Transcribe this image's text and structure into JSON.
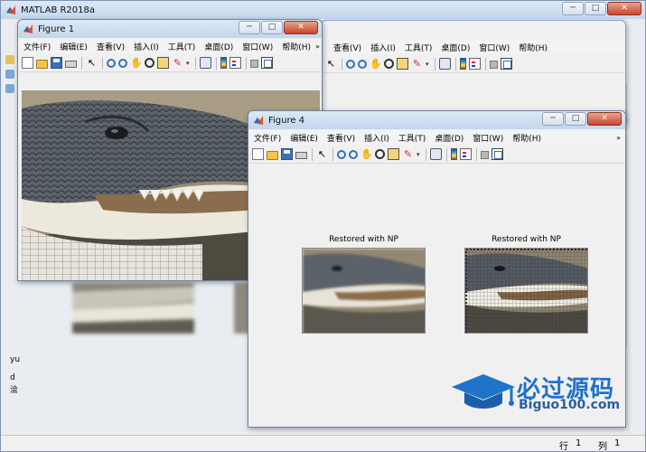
{
  "main_window": {
    "title": "MATLAB R2018a",
    "menu_behind": [
      "查看(V)",
      "插入(I)",
      "工具(T)",
      "桌面(D)",
      "窗口(W)",
      "帮助(H)"
    ],
    "command_snippets": [
      "yu",
      "d",
      "浍"
    ],
    "status": {
      "row_label": "行",
      "row_value": "1",
      "col_label": "列",
      "col_value": "1"
    }
  },
  "figure1": {
    "title": "Figure 1",
    "menu": [
      "文件(F)",
      "编辑(E)",
      "查看(V)",
      "插入(I)",
      "工具(T)",
      "桌面(D)",
      "窗口(W)",
      "帮助(H)"
    ],
    "menu_more": "»",
    "photo": "alligator"
  },
  "figure4": {
    "title": "Figure 4",
    "menu": [
      "文件(F)",
      "编辑(E)",
      "查看(V)",
      "插入(I)",
      "工具(T)",
      "桌面(D)",
      "窗口(W)",
      "帮助(H)"
    ],
    "menu_more": "»",
    "plots": [
      {
        "title": "Restored with NP"
      },
      {
        "title": "Restored with NP"
      }
    ]
  },
  "window_buttons": {
    "minimize": "─",
    "maximize": "□",
    "close": "✕"
  },
  "watermark": {
    "big": "必过源码",
    "small": "Biguo100.com"
  },
  "colors": {
    "titlebar": "#c4d6ec",
    "close": "#c8452c",
    "watermark": "#1f73c8"
  }
}
